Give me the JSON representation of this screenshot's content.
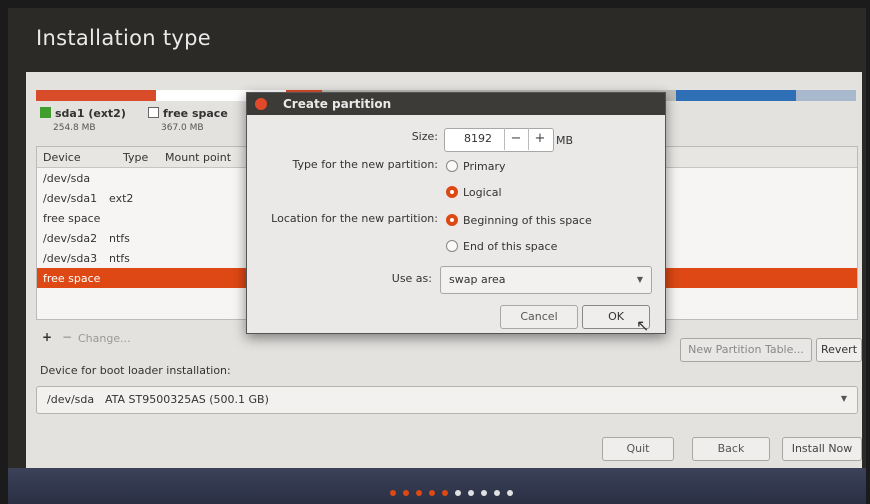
{
  "header": {
    "title": "Installation type"
  },
  "partition_bar": [
    {
      "name": "sda1 (ext2)",
      "size": "254.8 MB",
      "color": "#d84c2a"
    },
    {
      "name": "free space",
      "size": "367.0 MB",
      "color": "#ffffff"
    }
  ],
  "table": {
    "columns": [
      "Device",
      "Type",
      "Mount point"
    ],
    "rows": [
      {
        "device": "/dev/sda",
        "type": ""
      },
      {
        "device": "/dev/sda1",
        "type": "ext2"
      },
      {
        "device": "free space",
        "type": ""
      },
      {
        "device": "/dev/sda2",
        "type": "ntfs"
      },
      {
        "device": "/dev/sda3",
        "type": "ntfs"
      },
      {
        "device": "free space",
        "type": "",
        "selected": true
      }
    ]
  },
  "table_toolbar": {
    "add": "+",
    "remove": "−",
    "change": "Change...",
    "new_table": "New Partition Table...",
    "revert": "Revert"
  },
  "boot_loader": {
    "label": "Device for boot loader installation:",
    "device": "/dev/sda",
    "description": "ATA ST9500325AS (500.1 GB)"
  },
  "footer": {
    "quit": "Quit",
    "back": "Back",
    "install": "Install Now"
  },
  "dialog": {
    "title": "Create partition",
    "size_label": "Size:",
    "size_value": "8192",
    "size_minus": "−",
    "size_plus": "+",
    "size_unit": "MB",
    "type_label": "Type for the new partition:",
    "type_primary": "Primary",
    "type_logical": "Logical",
    "location_label": "Location for the new partition:",
    "location_begin": "Beginning of this space",
    "location_end": "End of this space",
    "useas_label": "Use as:",
    "useas_value": "swap area",
    "cancel": "Cancel",
    "ok": "OK"
  },
  "colors": {
    "accent": "#dd4814",
    "ext2": "#d84c2a",
    "ntfs": "#2f6fb5"
  }
}
